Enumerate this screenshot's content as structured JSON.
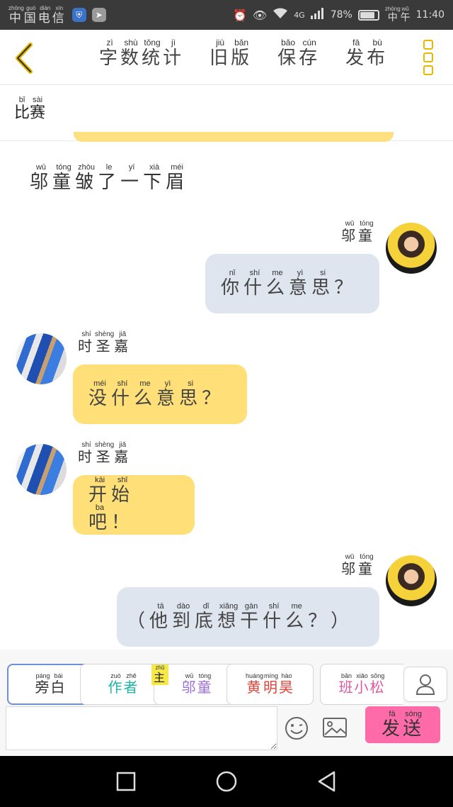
{
  "status_bar": {
    "carrier": [
      "中",
      "国",
      "电",
      "信"
    ],
    "carrier_pinyin": [
      "zhōng",
      "guó",
      "diàn",
      "xìn"
    ],
    "signal_label": "4G",
    "battery": "78%",
    "battery_level": 0.78,
    "time_prefix": [
      "中",
      "午"
    ],
    "time_prefix_pinyin": [
      "zhōng",
      "wǔ"
    ],
    "time": "11:40"
  },
  "header": {
    "actions": [
      {
        "chars": [
          "字",
          "数",
          "统",
          "计"
        ],
        "pinyin": [
          "zì",
          "shù",
          "tǒng",
          "jì"
        ]
      },
      {
        "chars": [
          "旧",
          "版"
        ],
        "pinyin": [
          "jiù",
          "bǎn"
        ]
      },
      {
        "chars": [
          "保",
          "存"
        ],
        "pinyin": [
          "bǎo",
          "cún"
        ]
      },
      {
        "chars": [
          "发",
          "布"
        ],
        "pinyin": [
          "fā",
          "bù"
        ]
      }
    ]
  },
  "subbar": {
    "chars": [
      "比",
      "赛"
    ],
    "pinyin": [
      "bǐ",
      "sài"
    ]
  },
  "chat": {
    "narration": {
      "chars": [
        "邬",
        "童",
        "皱",
        "了",
        "一",
        "下",
        "眉"
      ],
      "pinyin": [
        "wū",
        "tóng",
        "zhòu",
        "le",
        "yī",
        "xià",
        "méi"
      ]
    },
    "messages": [
      {
        "side": "right",
        "speaker": {
          "chars": [
            "邬",
            "童"
          ],
          "pinyin": [
            "wū",
            "tóng"
          ]
        },
        "chars": [
          "你",
          "什",
          "么",
          "意",
          "思"
        ],
        "pinyin": [
          "nǐ",
          "shí",
          "me",
          "yì",
          "si"
        ],
        "tail": "？"
      },
      {
        "side": "left",
        "speaker": {
          "chars": [
            "时",
            "圣",
            "嘉"
          ],
          "pinyin": [
            "shí",
            "shèng",
            "jiā"
          ]
        },
        "chars": [
          "没",
          "什",
          "么",
          "意",
          "思"
        ],
        "pinyin": [
          "méi",
          "shí",
          "me",
          "yì",
          "si"
        ],
        "tail": "？"
      },
      {
        "side": "left",
        "speaker": {
          "chars": [
            "时",
            "圣",
            "嘉"
          ],
          "pinyin": [
            "shí",
            "shèng",
            "jiā"
          ]
        },
        "chars": [
          "开",
          "始",
          "吧"
        ],
        "pinyin": [
          "kāi",
          "shǐ",
          "ba"
        ],
        "tail": "！"
      },
      {
        "side": "right",
        "speaker": {
          "chars": [
            "邬",
            "童"
          ],
          "pinyin": [
            "wū",
            "tóng"
          ]
        },
        "head": "（",
        "chars": [
          "他",
          "到",
          "底",
          "想",
          "干",
          "什",
          "么"
        ],
        "pinyin": [
          "tā",
          "dào",
          "dǐ",
          "xiǎng",
          "gàn",
          "shí",
          "me"
        ],
        "tail": "？）"
      }
    ]
  },
  "roles": [
    {
      "chars": [
        "旁",
        "白"
      ],
      "pinyin": [
        "páng",
        "bái"
      ],
      "color": "#333333"
    },
    {
      "chars": [
        "作",
        "者"
      ],
      "pinyin": [
        "zuò",
        "zhě"
      ],
      "color": "#1db5a5"
    },
    {
      "tag": {
        "chars": [
          "主"
        ],
        "pinyin": [
          "zhǔ"
        ]
      },
      "chars": [
        "邬",
        "童"
      ],
      "pinyin": [
        "wū",
        "tóng"
      ],
      "color": "#9b6fd6"
    },
    {
      "chars": [
        "黄",
        "明",
        "昊"
      ],
      "pinyin": [
        "huáng",
        "míng",
        "hào"
      ],
      "color": "#e0443a"
    },
    {
      "chars": [
        "班",
        "小",
        "松"
      ],
      "pinyin": [
        "bān",
        "xiǎo",
        "sōng"
      ],
      "color": "#e05aa0"
    }
  ],
  "input": {
    "placeholder": "",
    "value": ""
  },
  "send": {
    "chars": [
      "发",
      "送"
    ],
    "pinyin": [
      "fā",
      "sòng"
    ]
  },
  "colors": {
    "accent_yellow": "#ffdf78",
    "bubble_gray": "#dfe5ef",
    "send_pink": "#ff6aa9",
    "menu_yellow": "#e6b800"
  },
  "icons": {
    "back": "chevron-left-icon",
    "menu": "more-vertical-icon",
    "profile": "person-icon",
    "emoji": "emoji-icon",
    "image": "image-icon"
  }
}
